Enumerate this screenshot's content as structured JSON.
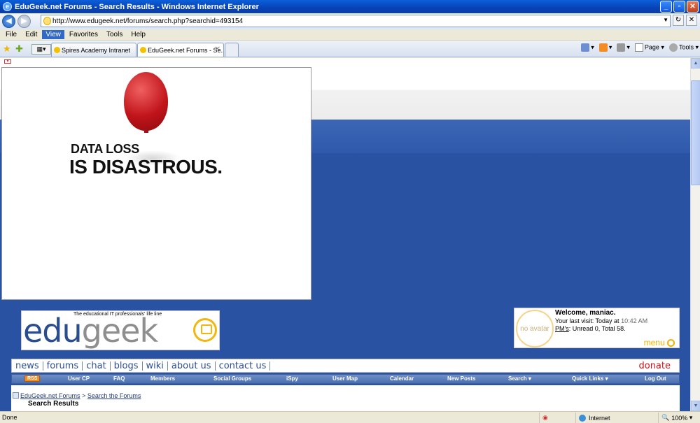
{
  "window": {
    "title": "EduGeek.net Forums - Search Results - Windows Internet Explorer"
  },
  "address": {
    "url": "http://www.edugeek.net/forums/search.php?searchid=493154"
  },
  "menubar": {
    "items": [
      "File",
      "Edit",
      "View",
      "Favorites",
      "Tools",
      "Help"
    ],
    "selected": "View"
  },
  "tabs": [
    {
      "label": "Spires Academy Intranet"
    },
    {
      "label": "EduGeek.net Forums - Se..."
    }
  ],
  "commandbar": {
    "page": "Page",
    "tools": "Tools"
  },
  "ad": {
    "line1": "DATA LOSS",
    "line2": "IS DISASTROUS."
  },
  "logo": {
    "tagline": "The educational IT professionals' life line",
    "part1": "edu",
    "part2": "geek"
  },
  "welcome": {
    "avatar_text": "no avatar",
    "title": "Welcome, maniac.",
    "last_visit_label": "Your last visit: Today at",
    "last_visit_time": "10:42 AM",
    "pms_label": "PM's",
    "pms_value": ": Unread 0, Total 58.",
    "menu": "menu"
  },
  "mainnav": {
    "items": [
      "news",
      "forums",
      "chat",
      "blogs",
      "wiki",
      "about us",
      "contact us"
    ],
    "donate": "donate"
  },
  "linkbar": {
    "rss": "RSS",
    "items": [
      "User CP",
      "FAQ",
      "Members",
      "Social Groups",
      "iSpy",
      "User Map",
      "Calendar",
      "New Posts",
      "Search ▾",
      "Quick Links ▾",
      "Log Out"
    ]
  },
  "breadcrumb": {
    "home": "EduGeek.net Forums",
    "sep": ">",
    "parent": "Search the Forums",
    "current": "Search Results"
  },
  "status": {
    "left": "Done",
    "zone": "Internet",
    "zoom": "100%"
  },
  "colors": {
    "brand_blue": "#2952a3",
    "accent_orange": "#f2b70f",
    "donate_red": "#c8141a"
  }
}
